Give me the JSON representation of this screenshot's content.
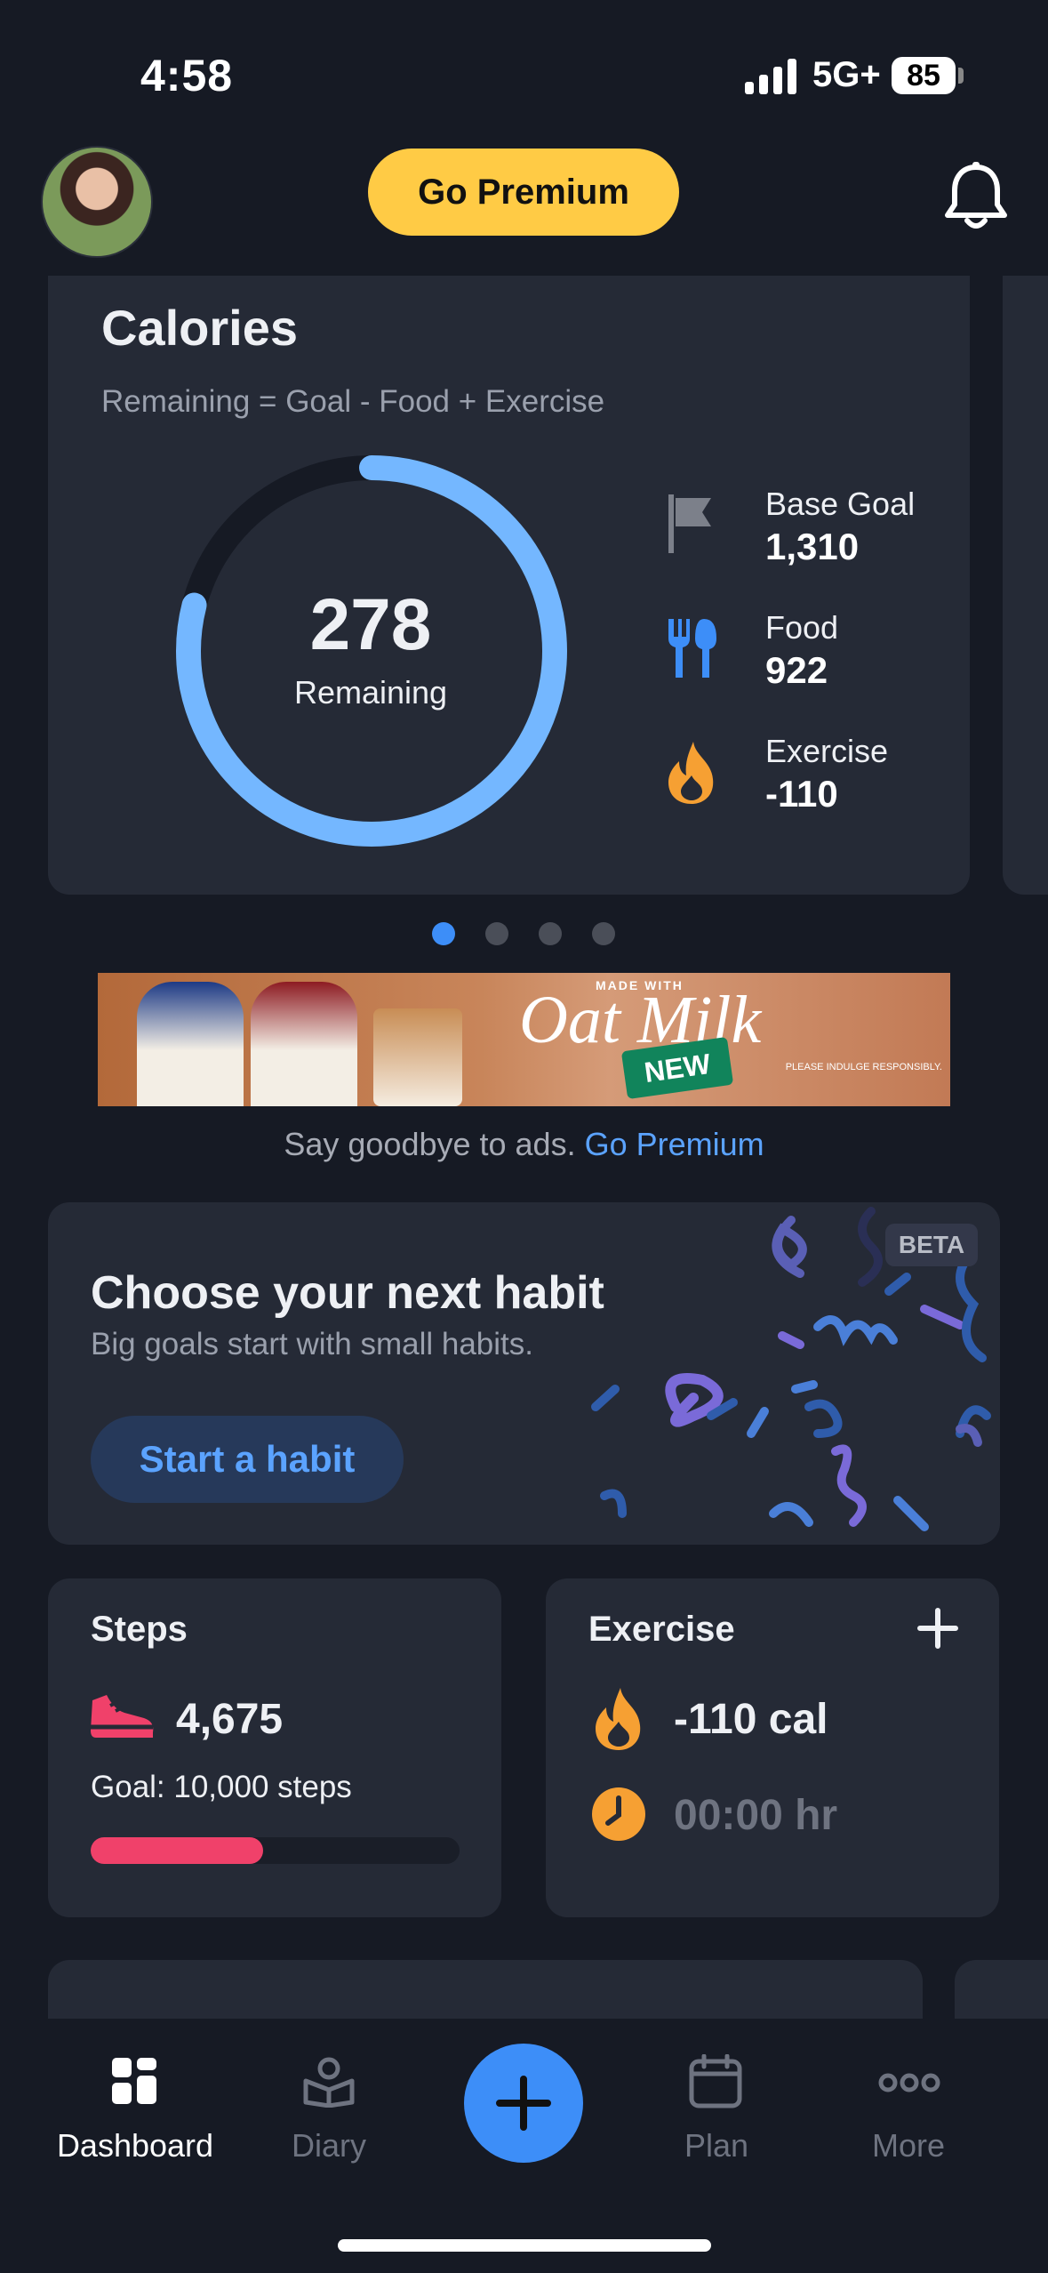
{
  "status_bar": {
    "time": "4:58",
    "network": "5G+",
    "battery": "85"
  },
  "header": {
    "premium_label": "Go Premium"
  },
  "calories": {
    "title": "Calories",
    "formula": "Remaining = Goal - Food + Exercise",
    "remaining_value": "278",
    "remaining_label": "Remaining",
    "ring_fraction": 0.79,
    "stats": [
      {
        "label": "Base Goal",
        "value": "1,310",
        "icon": "flag-icon"
      },
      {
        "label": "Food",
        "value": "922",
        "icon": "utensils-icon"
      },
      {
        "label": "Exercise",
        "value": "-110",
        "icon": "flame-icon"
      }
    ]
  },
  "pager": {
    "count": 4,
    "active": 0
  },
  "ad": {
    "brand_text": "MADE WITH",
    "headline": "Oat Milk",
    "badge": "NEW",
    "fine_print": "PLEASE INDULGE RESPONSIBLY.",
    "caption": "Say goodbye to ads.",
    "caption_link": "Go Premium"
  },
  "habit": {
    "badge": "BETA",
    "title": "Choose your next habit",
    "subtitle": "Big goals start with small habits.",
    "button": "Start a habit"
  },
  "steps": {
    "title": "Steps",
    "value": "4,675",
    "goal": "Goal: 10,000 steps",
    "progress": 0.4675
  },
  "exercise": {
    "title": "Exercise",
    "calories": "-110 cal",
    "duration": "00:00 hr"
  },
  "tabs": [
    {
      "label": "Dashboard",
      "icon": "dashboard-icon",
      "active": true
    },
    {
      "label": "Diary",
      "icon": "diary-icon",
      "active": false
    },
    {
      "label": "Plan",
      "icon": "calendar-icon",
      "active": false
    },
    {
      "label": "More",
      "icon": "more-icon",
      "active": false
    }
  ],
  "colors": {
    "background": "#161a24",
    "card": "#252a36",
    "accent_blue": "#5ba3ff",
    "ring_blue": "#74b7ff",
    "premium_yellow": "#ffcb45",
    "steps_pink": "#f0416a",
    "exercise_orange": "#f6a033"
  }
}
